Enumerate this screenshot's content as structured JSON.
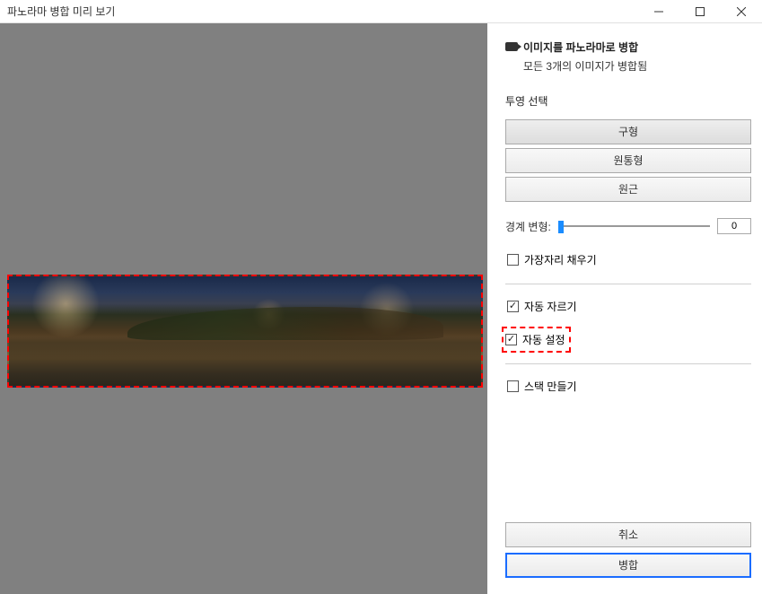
{
  "window": {
    "title": "파노라마 병합 미리 보기"
  },
  "header": {
    "title": "이미지를 파노라마로 병합",
    "subtitle": "모든 3개의 이미지가 병합됨"
  },
  "projection": {
    "label": "투영 선택",
    "buttons": {
      "spherical": "구형",
      "cylindrical": "원통형",
      "perspective": "원근"
    },
    "selected": "spherical"
  },
  "boundary": {
    "label": "경계 변형:",
    "value": "0"
  },
  "checkboxes": {
    "fill_edges": {
      "label": "가장자리 채우기",
      "checked": false
    },
    "auto_crop": {
      "label": "자동 자르기",
      "checked": true
    },
    "auto_settings": {
      "label": "자동 설정",
      "checked": true
    },
    "create_stack": {
      "label": "스택 만들기",
      "checked": false
    }
  },
  "actions": {
    "cancel": "취소",
    "merge": "병합"
  }
}
